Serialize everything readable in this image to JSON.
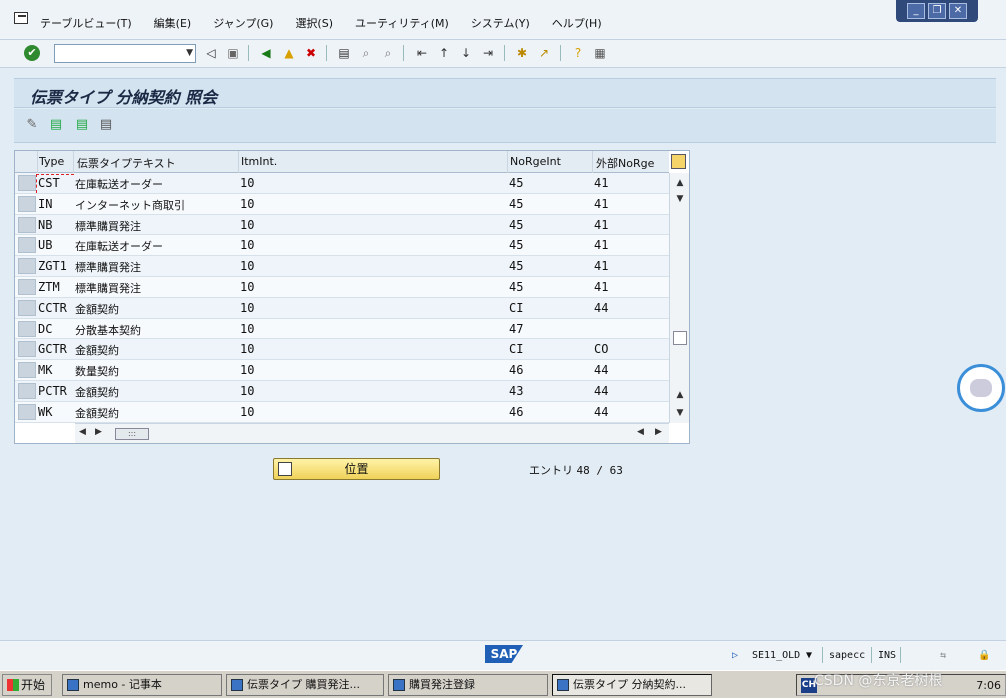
{
  "menu": {
    "items": [
      "テーブルビュー(T)",
      "編集(E)",
      "ジャンプ(G)",
      "選択(S)",
      "ユーティリティ(M)",
      "システム(Y)",
      "ヘルプ(H)"
    ]
  },
  "window_controls": [
    "_",
    "❐",
    "✕"
  ],
  "toolbar": {
    "command_field": "",
    "icons": [
      "back-icon",
      "save-icon",
      "exit-icon",
      "cancel-icon",
      "print-icon",
      "find-icon",
      "find-next-icon",
      "first-page-icon",
      "prev-page-icon",
      "next-page-icon",
      "last-page-icon",
      "create-session-icon",
      "shortcut-icon",
      "help-icon",
      "layout-icon"
    ]
  },
  "page": {
    "title": "伝票タイプ 分納契約 照会"
  },
  "table": {
    "columns": [
      "Type",
      "伝票タイプテキスト",
      "ItmInt.",
      "NoRgeInt",
      "外部NoRge"
    ],
    "rows": [
      {
        "type": "CST",
        "text": "在庫転送オーダー",
        "itm": "10",
        "norge": "45",
        "ext": "41"
      },
      {
        "type": "IN",
        "text": "インターネット商取引",
        "itm": "10",
        "norge": "45",
        "ext": "41"
      },
      {
        "type": "NB",
        "text": "標準購買発注",
        "itm": "10",
        "norge": "45",
        "ext": "41"
      },
      {
        "type": "UB",
        "text": "在庫転送オーダー",
        "itm": "10",
        "norge": "45",
        "ext": "41"
      },
      {
        "type": "ZGT1",
        "text": "標準購買発注",
        "itm": "10",
        "norge": "45",
        "ext": "41"
      },
      {
        "type": "ZTM",
        "text": "標準購買発注",
        "itm": "10",
        "norge": "45",
        "ext": "41"
      },
      {
        "type": "CCTR",
        "text": "金額契約",
        "itm": "10",
        "norge": "CI",
        "ext": "44"
      },
      {
        "type": "DC",
        "text": "分散基本契約",
        "itm": "10",
        "norge": "47",
        "ext": ""
      },
      {
        "type": "GCTR",
        "text": "金額契約",
        "itm": "10",
        "norge": "CI",
        "ext": "CO"
      },
      {
        "type": "MK",
        "text": "数量契約",
        "itm": "10",
        "norge": "46",
        "ext": "44"
      },
      {
        "type": "PCTR",
        "text": "金額契約",
        "itm": "10",
        "norge": "43",
        "ext": "44"
      },
      {
        "type": "WK",
        "text": "金額契約",
        "itm": "10",
        "norge": "46",
        "ext": "44"
      }
    ]
  },
  "position_button": "位置",
  "entries": {
    "label": "エントリ",
    "value": "48 / 63"
  },
  "status": {
    "transaction": "SE11_OLD",
    "system": "sapecc",
    "mode": "INS",
    "logo": "SAP"
  },
  "taskbar": {
    "start": "开始",
    "tasks": [
      "memo - 记事本",
      "伝票タイプ 購買発注...",
      "購買発注登録",
      "伝票タイプ 分納契約..."
    ],
    "tray_lang": "CH",
    "clock": "7:06"
  },
  "watermark": "CSDN @东京老树根"
}
